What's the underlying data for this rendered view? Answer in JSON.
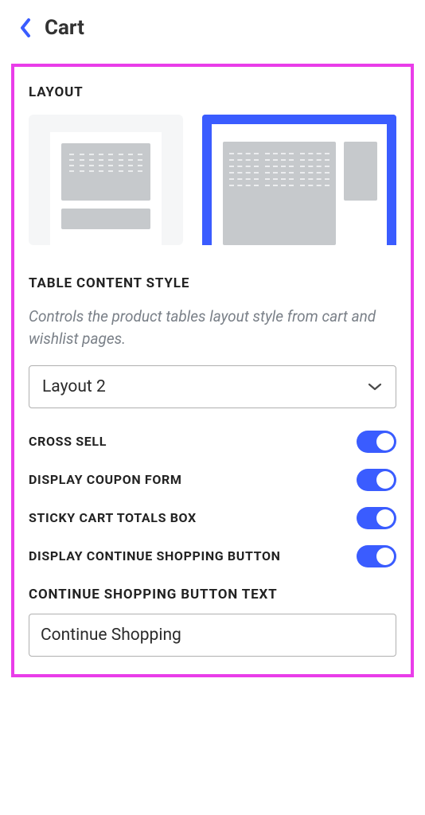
{
  "header": {
    "title": "Cart"
  },
  "layout": {
    "label": "Layout",
    "selected": 1
  },
  "tableContentStyle": {
    "label": "Table Content Style",
    "description": "Controls the product tables layout style from cart and wishlist pages.",
    "value": "Layout 2"
  },
  "toggles": {
    "crossSell": {
      "label": "Cross Sell",
      "value": true
    },
    "couponForm": {
      "label": "Display Coupon Form",
      "value": true
    },
    "stickyTotals": {
      "label": "Sticky Cart Totals Box",
      "value": true
    },
    "continueBtn": {
      "label": "Display Continue Shopping Button",
      "value": true
    }
  },
  "continueText": {
    "label": "Continue Shopping Button Text",
    "value": "Continue Shopping"
  }
}
